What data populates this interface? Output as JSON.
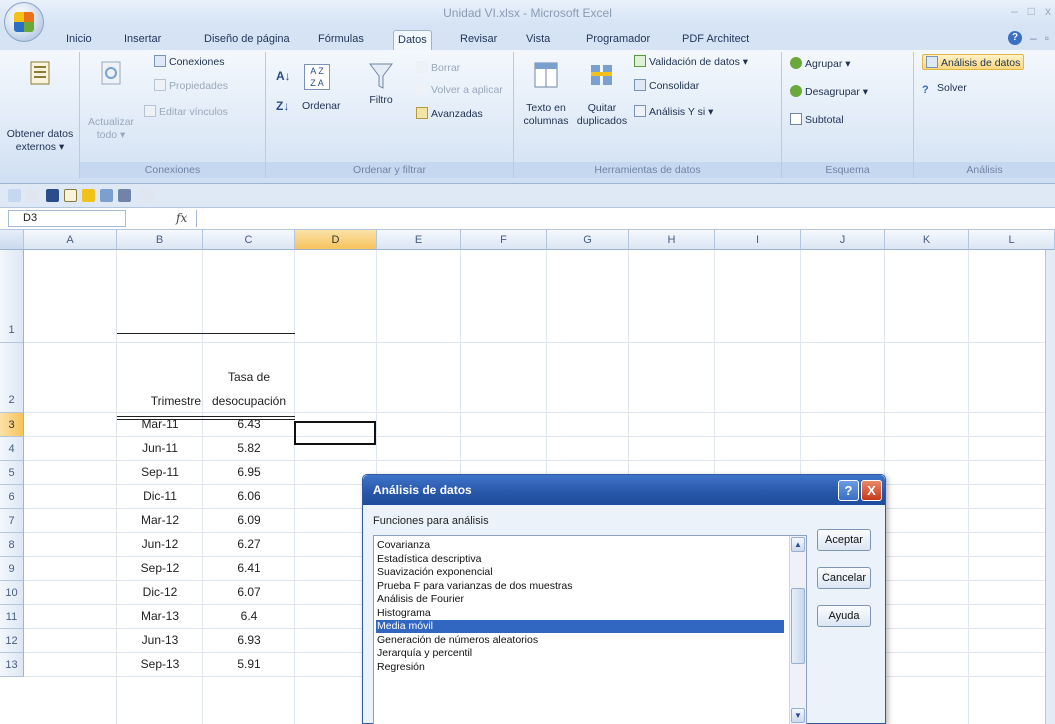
{
  "window": {
    "title": "Unidad VI.xlsx - Microsoft Excel",
    "min": "–",
    "max": "□",
    "close": "x"
  },
  "tabs": [
    "Inicio",
    "Insertar",
    "Diseño de página",
    "Fórmulas",
    "Datos",
    "Revisar",
    "Vista",
    "Programador",
    "PDF Architect"
  ],
  "active_tab": "Datos",
  "ribbon": {
    "obtener": {
      "label1": "Obtener datos",
      "label2": "externos ▾"
    },
    "conexiones": {
      "actualizar1": "Actualizar",
      "actualizar2": "todo ▾",
      "conexiones": "Conexiones",
      "propiedades": "Propiedades",
      "editar": "Editar vínculos",
      "group": "Conexiones"
    },
    "ordenar": {
      "ordenar": "Ordenar",
      "filtro": "Filtro",
      "borrar": "Borrar",
      "volver": "Volver a aplicar",
      "avanzadas": "Avanzadas",
      "group": "Ordenar y filtrar"
    },
    "herramientas": {
      "texto1": "Texto en",
      "texto2": "columnas",
      "quitar1": "Quitar",
      "quitar2": "duplicados",
      "validacion": "Validación de datos ▾",
      "consolidar": "Consolidar",
      "analisis_ysi": "Análisis Y si ▾",
      "group": "Herramientas de datos"
    },
    "esquema": {
      "agrupar": "Agrupar ▾",
      "desagrupar": "Desagrupar ▾",
      "subtotal": "Subtotal",
      "group": "Esquema"
    },
    "analisis": {
      "analisis_datos": "Análisis de datos",
      "solver": "Solver",
      "group": "Análisis"
    }
  },
  "formula_bar": {
    "name_box": "D3",
    "fx": "fx",
    "formula": ""
  },
  "columns": [
    "A",
    "B",
    "C",
    "D",
    "E",
    "F",
    "G",
    "H",
    "I",
    "J",
    "K",
    "L"
  ],
  "selected_column": "D",
  "rows": [
    "1",
    "2",
    "3",
    "4",
    "5",
    "6",
    "7",
    "8",
    "9",
    "10",
    "11",
    "12",
    "13"
  ],
  "selected_row": "3",
  "sheet": {
    "header_b": "Trimestre",
    "header_c1": "Tasa de",
    "header_c2": "desocupación",
    "data": [
      [
        "Mar-11",
        "6.43"
      ],
      [
        "Jun-11",
        "5.82"
      ],
      [
        "Sep-11",
        "6.95"
      ],
      [
        "Dic-11",
        "6.06"
      ],
      [
        "Mar-12",
        "6.09"
      ],
      [
        "Jun-12",
        "6.27"
      ],
      [
        "Sep-12",
        "6.41"
      ],
      [
        "Dic-12",
        "6.07"
      ],
      [
        "Mar-13",
        "6.4"
      ],
      [
        "Jun-13",
        "6.93"
      ],
      [
        "Sep-13",
        "5.91"
      ]
    ]
  },
  "dialog": {
    "title": "Análisis de datos",
    "help": "?",
    "close": "X",
    "list_label": "Funciones para análisis",
    "items": [
      "Covarianza",
      "Estadística descriptiva",
      "Suavización exponencial",
      "Prueba F para varianzas de dos muestras",
      "Análisis de Fourier",
      "Histograma",
      "Media móvil",
      "Generación de números aleatorios",
      "Jerarquía y percentil",
      "Regresión"
    ],
    "selected_item": "Media móvil",
    "buttons": {
      "ok": "Aceptar",
      "cancel": "Cancelar",
      "help": "Ayuda"
    }
  }
}
